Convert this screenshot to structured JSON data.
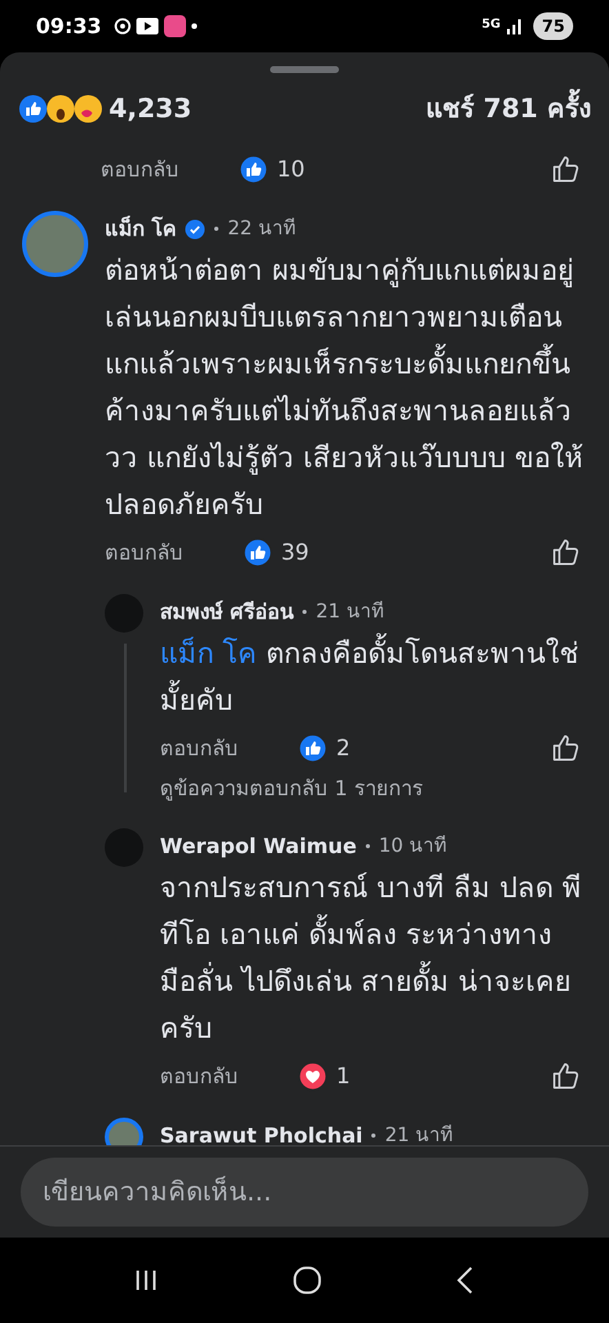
{
  "status_bar": {
    "time": "09:33",
    "network": "5G",
    "battery": "75"
  },
  "reactions_bar": {
    "count": "4,233",
    "shares": "แชร์ 781 ครั้ง"
  },
  "previous_comment": {
    "reply_label": "ตอบกลับ",
    "reaction": {
      "kind": "like"
    },
    "reaction_count": "10"
  },
  "comments": [
    {
      "author": "แม็ก โค",
      "verified": true,
      "story_ring": true,
      "time": "22 นาที",
      "text": "ต่อหน้าต่อตา ผมขับมาคู่กับแกแต่ผมอยู่เล่นนอกผมบีบแตรลากยาวพยามเตือนแกแล้วเพราะผมเห็รกระบะดั้มแกยกขึ้นค้างมาครับแต่ไม่ทันถึงสะพานลอยแล้ววว แกยังไม่รู้ตัว เสียวหัวแว๊บบบบ ขอให้ปลอดภัยครับ",
      "reply_label": "ตอบกลับ",
      "reaction": {
        "kind": "like"
      },
      "reaction_count": "39",
      "children": [
        {
          "author": "สมพงษ์ ศรีอ่อน",
          "verified": false,
          "story_ring": false,
          "time": "21 นาที",
          "mention": "แม็ก โค",
          "text": "ตกลงคือดั้มโดนสะพานใช่มั้ยคับ",
          "reply_label": "ตอบกลับ",
          "reaction": {
            "kind": "like"
          },
          "reaction_count": "2",
          "more_replies": "ดูข้อความตอบกลับ 1 รายการ"
        },
        {
          "author": "Werapol Waimue",
          "verified": false,
          "story_ring": false,
          "time": "10 นาที",
          "text": "จากประสบการณ์ บางที ลืม ปลด พีทีโอ เอาแค่ ดั้มพ์ลง ระหว่างทาง มือลั่น ไปดึงเล่น  สายดั้ม น่าจะเคย ครับ",
          "reply_label": "ตอบกลับ",
          "reaction": {
            "kind": "love"
          },
          "reaction_count": "1"
        },
        {
          "author": "Sarawut Pholchai",
          "verified": false,
          "story_ring": true,
          "time": "21 นาที"
        }
      ]
    }
  ],
  "composer": {
    "placeholder": "เขียนความคิดเห็น..."
  }
}
